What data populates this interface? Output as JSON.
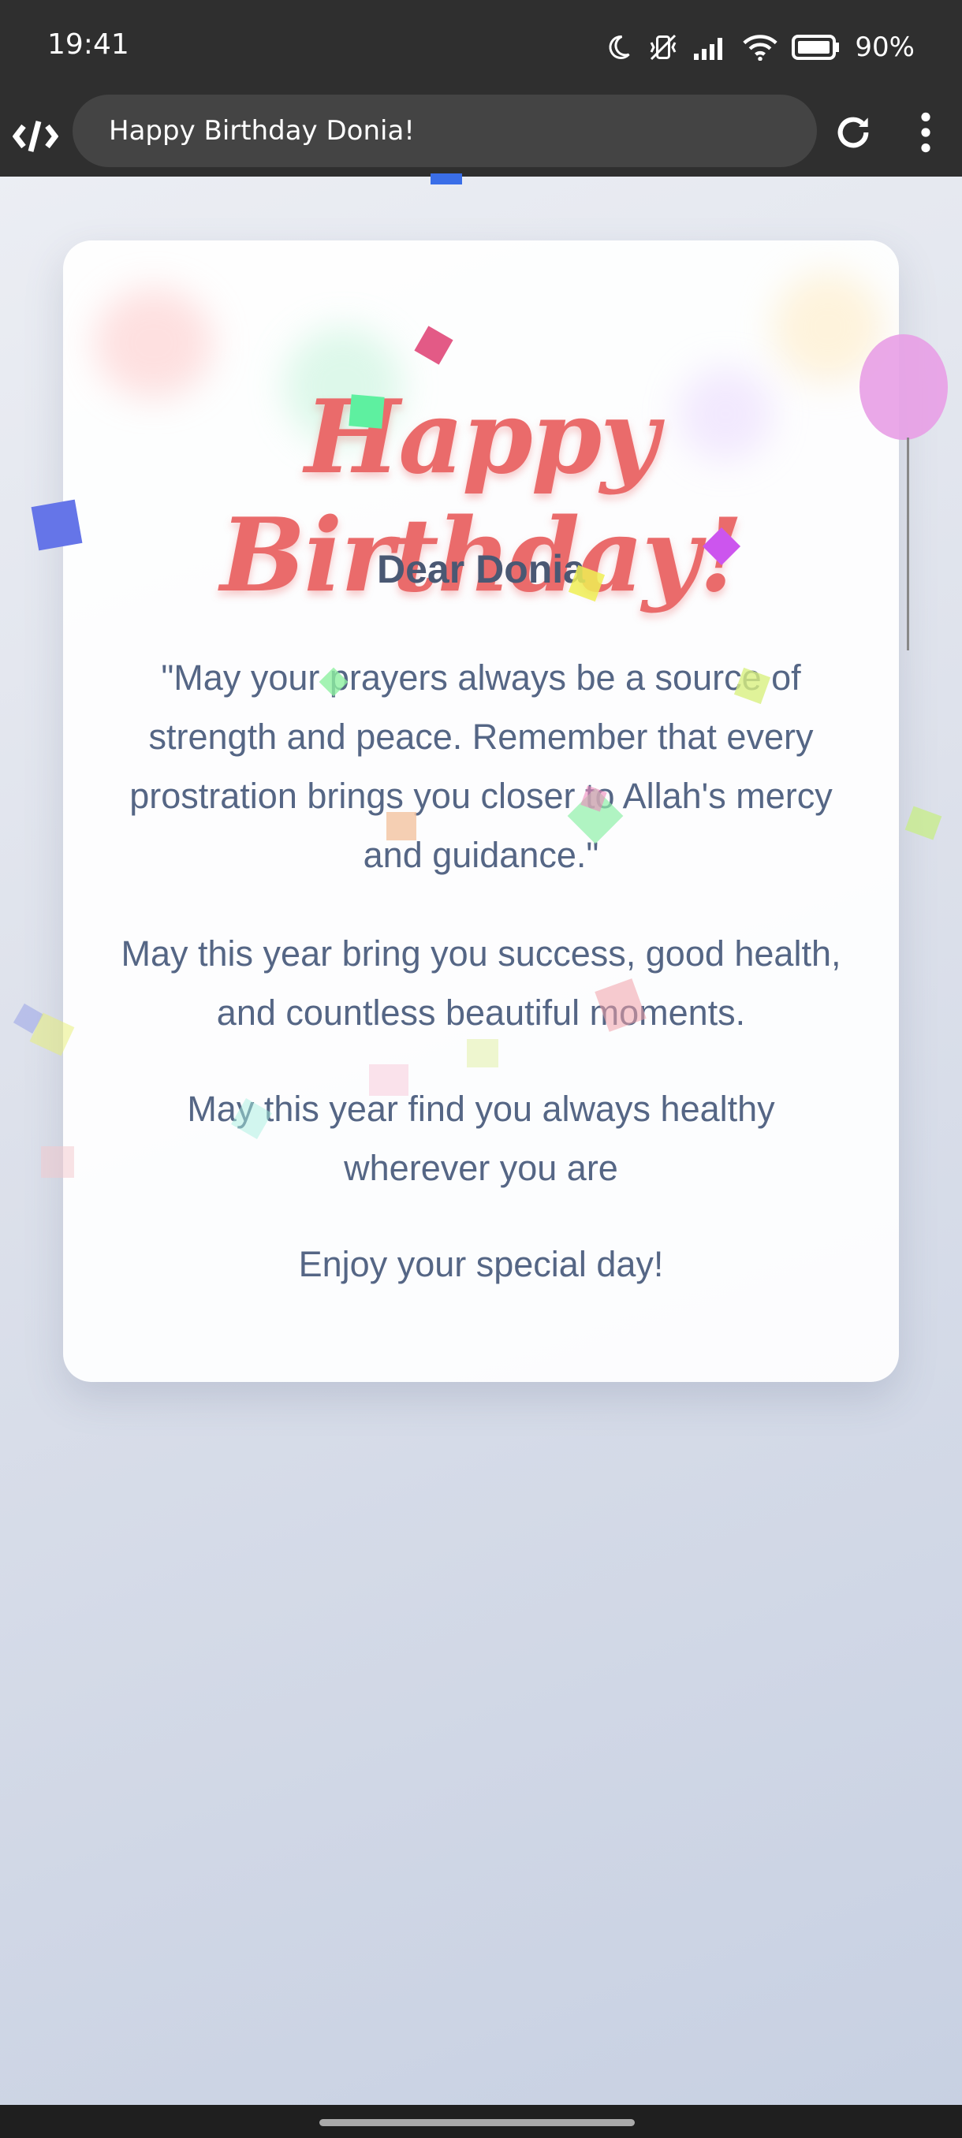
{
  "status": {
    "time": "19:41",
    "battery_text": "90%",
    "icons": [
      "moon-icon",
      "vibrate-off-icon",
      "signal-icon",
      "wifi-icon",
      "battery-icon"
    ]
  },
  "browser": {
    "title": "Happy Birthday Donia!",
    "icons": [
      "site-logo-icon",
      "reload-icon",
      "more-vert-icon"
    ]
  },
  "card": {
    "heading": "Happy Birthday!",
    "greeting": "Dear Donia",
    "paragraph_1": "\"May your prayers always be a source of strength and peace. Remember that every prostration brings you closer to Allah's mercy and guidance.\"",
    "paragraph_2": "May this year bring you success, good health, and countless beautiful moments.",
    "paragraph_3": "May this year find you always healthy wherever you are",
    "paragraph_4": "Enjoy your special day!"
  },
  "colors": {
    "heading": "#ea6b6b",
    "text": "#556685",
    "greeting": "#4a5873",
    "chrome": "#2f2f2f"
  }
}
